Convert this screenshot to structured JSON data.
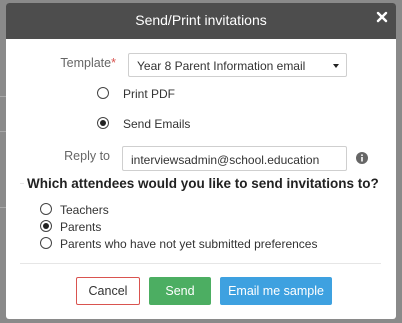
{
  "dialog": {
    "title": "Send/Print invitations",
    "close_icon": "close-icon"
  },
  "template": {
    "label": "Template",
    "required_marker": "*",
    "selected": "Year 8 Parent Information email"
  },
  "output_options": [
    {
      "label": "Print PDF",
      "checked": false
    },
    {
      "label": "Send Emails",
      "checked": true
    }
  ],
  "reply_to": {
    "label": "Reply to",
    "value": "interviewsadmin@school.education",
    "info_icon": "info-icon"
  },
  "attendees": {
    "question": "Which attendees would you like to send invitations to?",
    "options": [
      {
        "label": "Teachers",
        "checked": false
      },
      {
        "label": "Parents",
        "checked": true
      },
      {
        "label": "Parents who have not yet submitted preferences",
        "checked": false
      }
    ]
  },
  "buttons": {
    "cancel": "Cancel",
    "send": "Send",
    "email_sample": "Email me sample"
  },
  "colors": {
    "header_bg": "#4d4d4d",
    "send_bg": "#4cae62",
    "sample_bg": "#3ea1e0",
    "cancel_border": "#d9534f",
    "required": "#d9534f"
  }
}
